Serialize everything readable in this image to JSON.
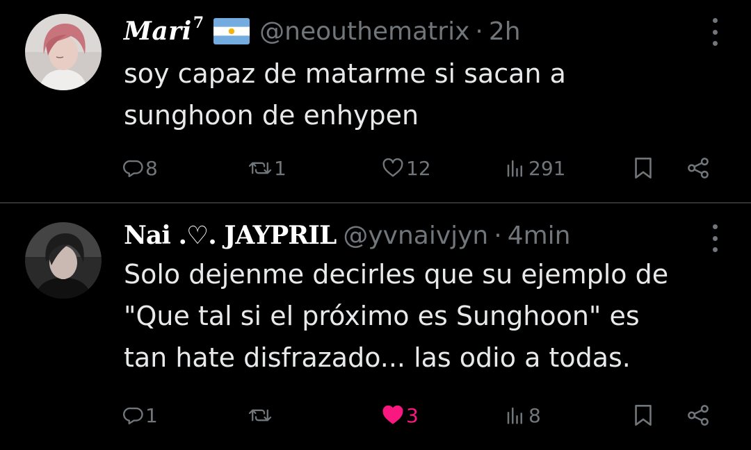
{
  "tweets": [
    {
      "author": {
        "display_name": "Mari",
        "superscript": "7",
        "flag": "argentina-flag",
        "handle": "@neouthematrix",
        "separator": "·",
        "time": "2h"
      },
      "text_lines": [
        "soy capaz de matarme si sacan a",
        "sunghoon de enhypen"
      ],
      "stats": {
        "replies": "8",
        "reposts": "1",
        "likes": "12",
        "views": "291"
      },
      "liked": false
    },
    {
      "author": {
        "display_name": "Nai .♡. JAYPRIL",
        "handle": "@yvnaivjyn",
        "separator": "·",
        "time": "4min"
      },
      "text_lines": [
        "Solo dejenme decirles que su ejemplo de",
        "\"Que tal si el próximo es Sunghoon\" es",
        "tan hate disfrazado... las odio a todas."
      ],
      "stats": {
        "replies": "1",
        "reposts": "",
        "likes": "3",
        "views": "8"
      },
      "liked": true
    }
  ],
  "colors": {
    "background": "#000000",
    "text_primary": "#e7e9ea",
    "text_secondary": "#71767b",
    "like_active": "#f91880",
    "divider": "#2f3336"
  },
  "icons": {
    "reply": "reply-icon",
    "repost": "repost-icon",
    "like": "heart-icon",
    "views": "views-icon",
    "bookmark": "bookmark-icon",
    "share": "share-icon",
    "more": "more-options-icon"
  }
}
